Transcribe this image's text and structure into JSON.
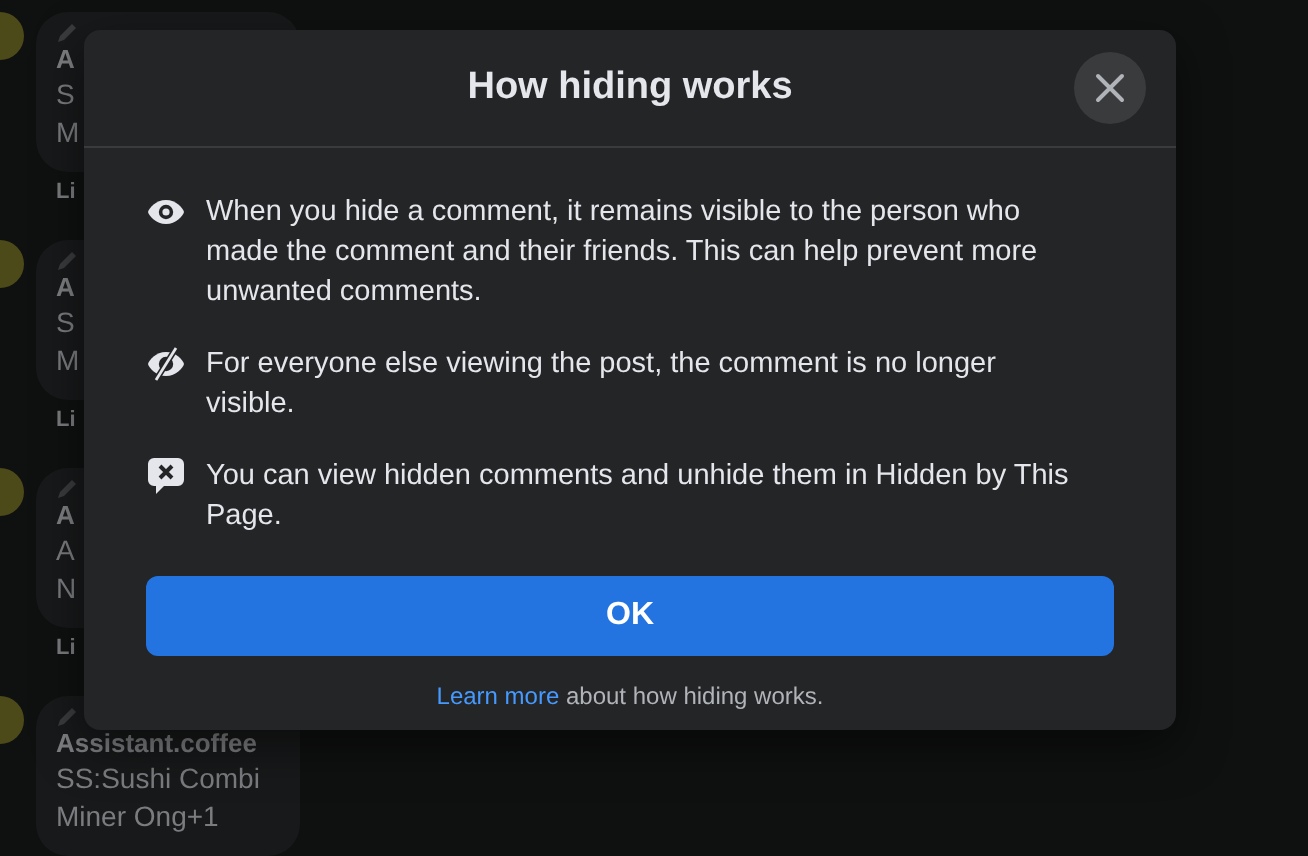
{
  "background_comments": [
    {
      "name": "A",
      "lines": [
        "S",
        "M"
      ],
      "actions": "Li"
    },
    {
      "name": "A",
      "lines": [
        "S",
        "M"
      ],
      "actions": "Li"
    },
    {
      "name": "A",
      "lines": [
        "A",
        "N"
      ],
      "actions": "Li"
    },
    {
      "name": "Assistant.coffee",
      "lines": [
        "SS:Sushi Combi",
        "Miner Ong+1"
      ]
    }
  ],
  "dialog": {
    "title": "How hiding works",
    "items": [
      {
        "kind": "visible",
        "text": "When you hide a comment, it remains visible to the person who made the comment and their friends. This can help prevent more unwanted comments."
      },
      {
        "kind": "hidden",
        "text": "For everyone else viewing the post, the comment is no longer visible."
      },
      {
        "kind": "hidden-comment",
        "text": "You can view hidden comments and unhide them in Hidden by This Page."
      }
    ],
    "ok_button": "OK",
    "footer": {
      "link": "Learn more",
      "text": "about how hiding works."
    }
  }
}
